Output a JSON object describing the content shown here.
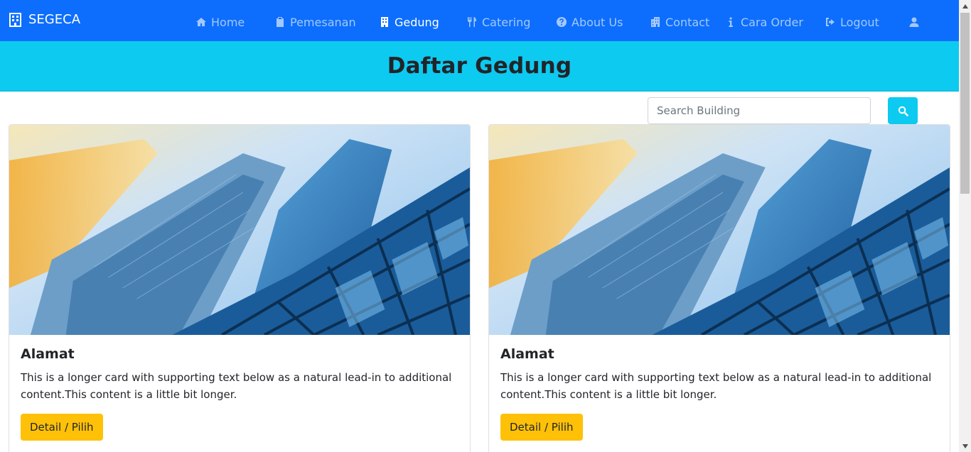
{
  "navbar": {
    "brand": "SEGECA",
    "items": [
      {
        "label": "Home",
        "icon": "home-icon"
      },
      {
        "label": "Pemesanan",
        "icon": "clipboard-icon"
      },
      {
        "label": "Gedung",
        "icon": "building-icon",
        "active": true
      },
      {
        "label": "Catering",
        "icon": "utensils-icon"
      },
      {
        "label": "About Us",
        "icon": "question-circle-icon"
      },
      {
        "label": "Contact",
        "icon": "hospital-building-icon"
      },
      {
        "label": "Cara Order",
        "icon": "info-icon"
      },
      {
        "label": "Logout",
        "icon": "sign-out-icon"
      }
    ],
    "user_icon": "user-icon",
    "colors": {
      "background": "#0d6efd",
      "active": "#ffffff",
      "inactive": "rgba(255,255,255,0.62)"
    }
  },
  "header": {
    "title": "Daftar Gedung",
    "background": "#0dcaf0"
  },
  "search": {
    "placeholder": "Search Building",
    "button_icon": "search-icon",
    "button_color": "#0dcaf0"
  },
  "cards": [
    {
      "image": "skyscraper-photo",
      "title": "Alamat",
      "text": "This is a longer card with supporting text below as a natural lead-in to additional content.This content is a little bit longer.",
      "button_label": "Detail / Pilih"
    },
    {
      "image": "skyscraper-photo",
      "title": "Alamat",
      "text": "This is a longer card with supporting text below as a natural lead-in to additional content.This content is a little bit longer.",
      "button_label": "Detail / Pilih"
    }
  ],
  "button_color": "#ffc107"
}
